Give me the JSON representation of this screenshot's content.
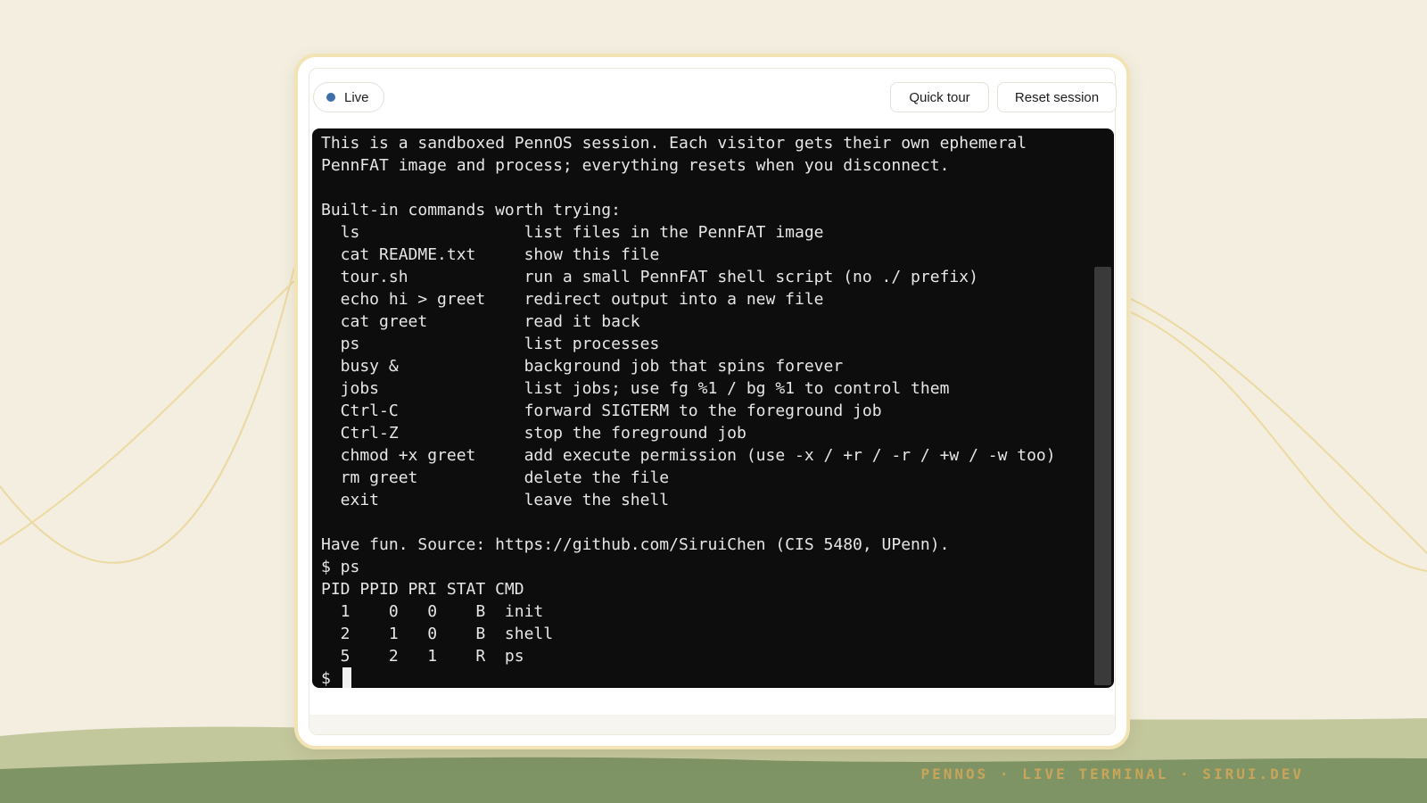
{
  "toolbar": {
    "status_label": "Live",
    "quick_tour_label": "Quick tour",
    "reset_session_label": "Reset session"
  },
  "terminal": {
    "lines": [
      "This is a sandboxed PennOS session. Each visitor gets their own ephemeral",
      "PennFAT image and process; everything resets when you disconnect.",
      "",
      "Built-in commands worth trying:",
      "  ls                 list files in the PennFAT image",
      "  cat README.txt     show this file",
      "  tour.sh            run a small PennFAT shell script (no ./ prefix)",
      "  echo hi > greet    redirect output into a new file",
      "  cat greet          read it back",
      "  ps                 list processes",
      "  busy &             background job that spins forever",
      "  jobs               list jobs; use fg %1 / bg %1 to control them",
      "  Ctrl-C             forward SIGTERM to the foreground job",
      "  Ctrl-Z             stop the foreground job",
      "  chmod +x greet     add execute permission (use -x / +r / -r / +w / -w too)",
      "  rm greet           delete the file",
      "  exit               leave the shell",
      "",
      "Have fun. Source: https://github.com/SiruiChen (CIS 5480, UPenn).",
      "$ ps",
      "PID PPID PRI STAT CMD",
      "  1    0   0    B  init",
      "  2    1   0    B  shell",
      "  5    2   1    R  ps"
    ],
    "prompt": "$ "
  },
  "watermark": "PENNOS · LIVE TERMINAL · SIRUI.DEV",
  "colors": {
    "background": "#f3eedf",
    "terminal_bg": "#0d0d0d",
    "terminal_fg": "#e6e6e6",
    "live_dot": "#3e6fa8",
    "card_border": "#f1e3b4",
    "hill_dark": "#7f9465",
    "hill_light": "#c3c79c",
    "watermark": "#c9a55a"
  },
  "icons": {
    "status": "live-dot-icon"
  }
}
